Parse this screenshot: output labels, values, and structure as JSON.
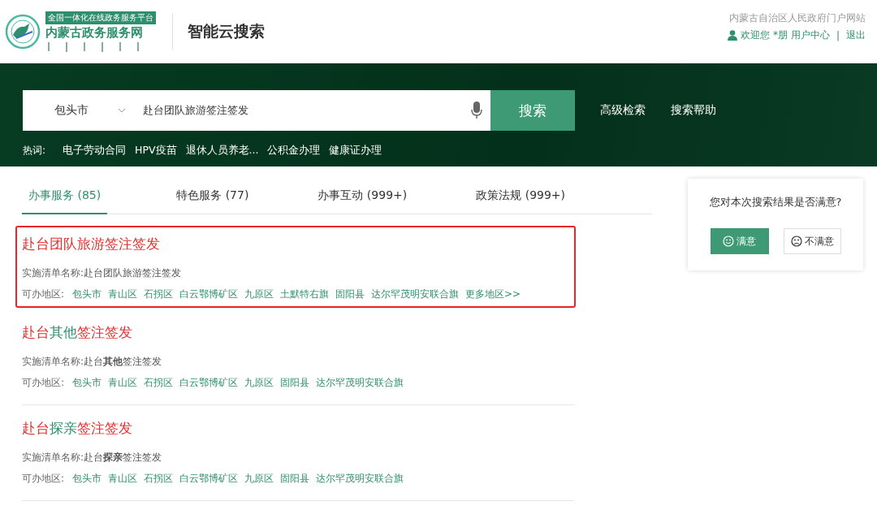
{
  "header": {
    "logo_banner": "全国一体化在线政务服务平台",
    "logo_name": "内蒙古政务服务网",
    "product": "智能云搜索",
    "portal_link": "内蒙古自治区人民政府门户网站",
    "greeting": "欢迎您 *朋",
    "user_center": "用户中心",
    "separator": "|",
    "logout": "退出"
  },
  "search": {
    "region": "包头市",
    "query": "赴台团队旅游签注签发",
    "button": "搜索",
    "links": [
      "高级检索",
      "搜索帮助"
    ],
    "hot_label": "热词:",
    "hot_words": [
      "电子劳动合同",
      "HPV疫苗",
      "退休人员养老...",
      "公积金办理",
      "健康证办理"
    ]
  },
  "tabs": [
    {
      "label": "办事服务 (85)",
      "selected": true
    },
    {
      "label": "特色服务 (77)",
      "selected": false
    },
    {
      "label": "办事互动 (999+)",
      "selected": false
    },
    {
      "label": "政策法规 (999+)",
      "selected": false
    }
  ],
  "results": [
    {
      "selected": true,
      "title": [
        {
          "text": "赴台团队旅游签注签发",
          "match": true
        }
      ],
      "name_label": "实施清单名称:",
      "name": "赴台团队旅游签注签发",
      "region_label": "可办地区:",
      "regions": [
        "包头市",
        "青山区",
        "石拐区",
        "白云鄂博矿区",
        "九原区",
        "土默特右旗",
        "固阳县",
        "达尔罕茂明安联合旗",
        "更多地区>>"
      ]
    },
    {
      "selected": false,
      "title": [
        {
          "text": "赴台",
          "match": true
        },
        {
          "text": "其他",
          "match": false
        },
        {
          "text": "签注签发",
          "match": true
        }
      ],
      "name_label": "实施清单名称:",
      "name": "赴台**其他**签注签发",
      "region_label": "可办地区:",
      "regions": [
        "包头市",
        "青山区",
        "石拐区",
        "白云鄂博矿区",
        "九原区",
        "固阳县",
        "达尔罕茂明安联合旗"
      ]
    },
    {
      "selected": false,
      "title": [
        {
          "text": "赴台",
          "match": true
        },
        {
          "text": "探亲",
          "match": false
        },
        {
          "text": "签注签发",
          "match": true
        }
      ],
      "name_label": "实施清单名称:",
      "name": "赴台**探亲**签注签发",
      "region_label": "可办地区:",
      "regions": [
        "包头市",
        "青山区",
        "石拐区",
        "白云鄂博矿区",
        "九原区",
        "固阳县",
        "达尔罕茂明安联合旗"
      ]
    }
  ],
  "feedback": {
    "question": "您对本次搜索结果是否满意?",
    "buttons": [
      {
        "label": "满意",
        "selected": true
      },
      {
        "label": "不满意",
        "selected": false
      }
    ]
  }
}
